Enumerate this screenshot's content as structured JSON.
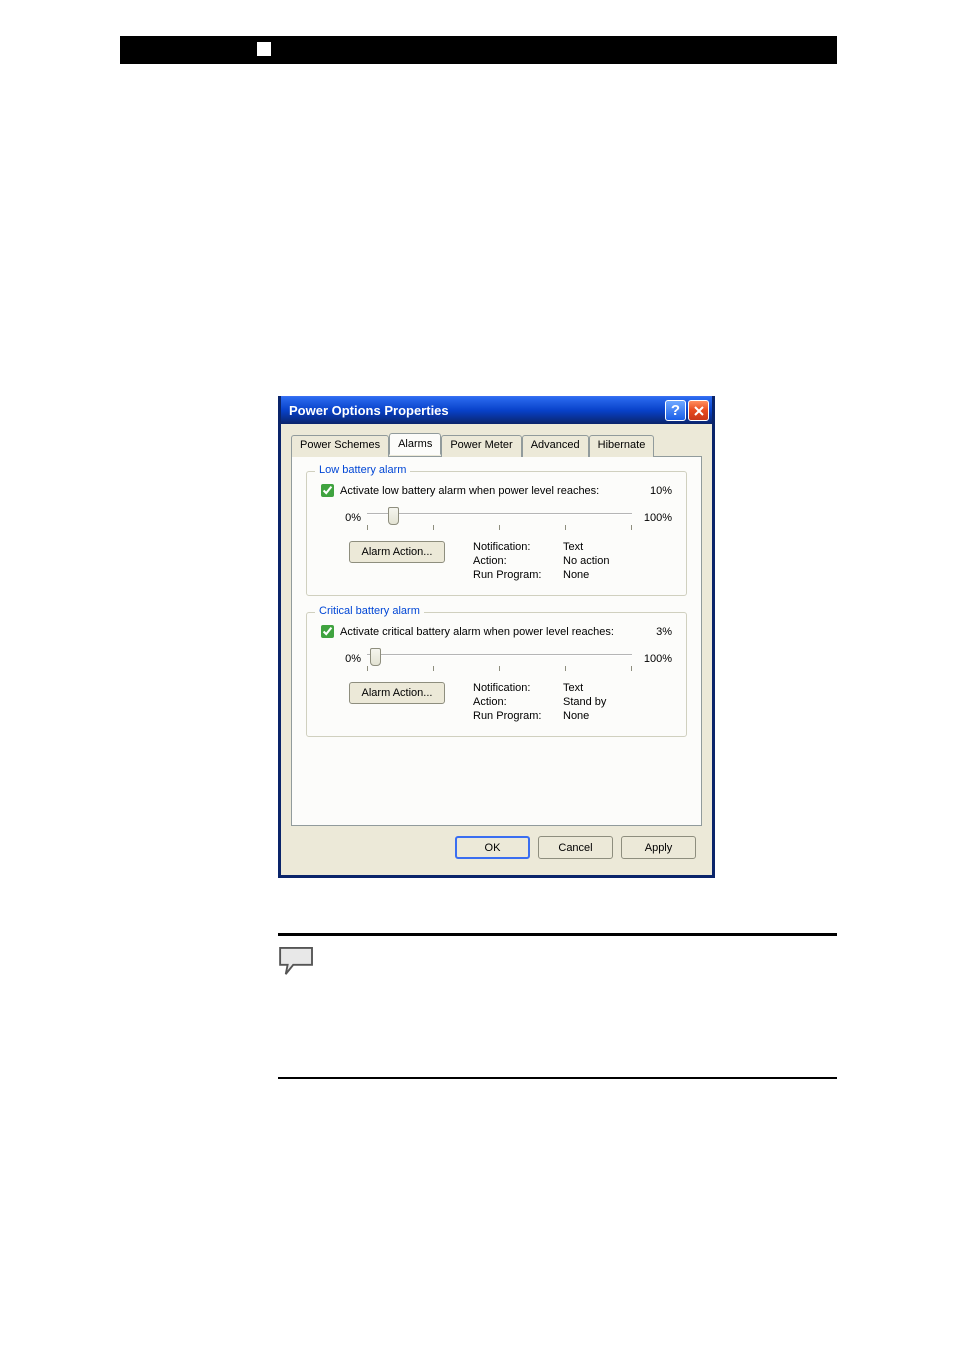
{
  "dialog": {
    "title": "Power Options Properties",
    "tabs": [
      "Power Schemes",
      "Alarms",
      "Power Meter",
      "Advanced",
      "Hibernate"
    ],
    "active_tab_index": 1,
    "low_alarm": {
      "legend": "Low battery alarm",
      "checkbox_label": "Activate low battery alarm when power level reaches:",
      "checked": true,
      "value_pct": "10%",
      "slider_min": "0%",
      "slider_max": "100%",
      "alarm_action_btn": "Alarm Action...",
      "rows": {
        "Notification:": "Text",
        "Action:": "No action",
        "Run Program:": "None"
      }
    },
    "critical_alarm": {
      "legend": "Critical battery alarm",
      "checkbox_label": "Activate critical battery alarm when power level reaches:",
      "checked": true,
      "value_pct": "3%",
      "slider_min": "0%",
      "slider_max": "100%",
      "alarm_action_btn": "Alarm Action...",
      "rows": {
        "Notification:": "Text",
        "Action:": "Stand by",
        "Run Program:": "None"
      }
    },
    "buttons": {
      "ok": "OK",
      "cancel": "Cancel",
      "apply": "Apply"
    }
  }
}
